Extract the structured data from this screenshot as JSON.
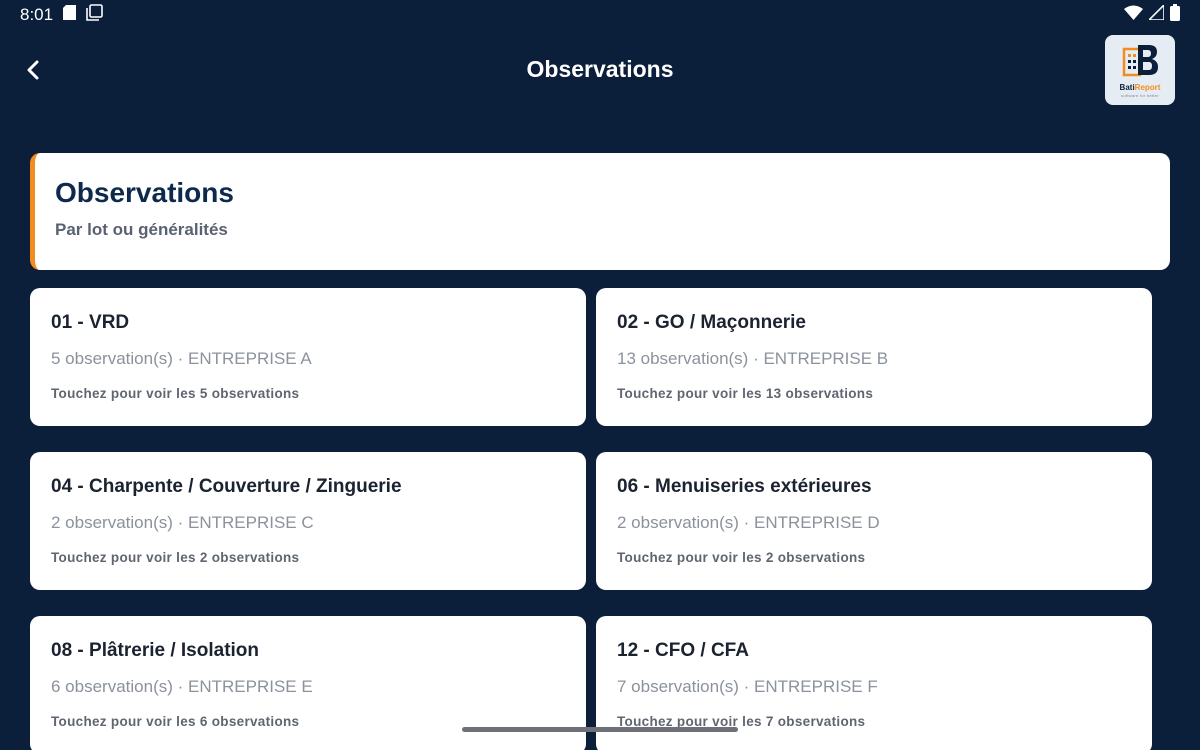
{
  "status_bar": {
    "time": "8:01"
  },
  "app_bar": {
    "title": "Observations",
    "logo": {
      "brand_part1": "Bati",
      "brand_part2": "Report",
      "tagline": "software for better"
    }
  },
  "header": {
    "title": "Observations",
    "subtitle": "Par lot ou généralités"
  },
  "lots": [
    {
      "title": "01 - VRD",
      "meta": "5 observation(s) · ENTREPRISE A",
      "hint": "Touchez pour voir les 5 observations"
    },
    {
      "title": "02 - GO / Maçonnerie",
      "meta": "13 observation(s) · ENTREPRISE B",
      "hint": "Touchez pour voir les 13 observations"
    },
    {
      "title": "04 - Charpente / Couverture / Zinguerie",
      "meta": "2 observation(s) · ENTREPRISE C",
      "hint": "Touchez pour voir les 2 observations"
    },
    {
      "title": "06 - Menuiseries extérieures",
      "meta": "2 observation(s) · ENTREPRISE D",
      "hint": "Touchez pour voir les 2 observations"
    },
    {
      "title": "08 - Plâtrerie / Isolation",
      "meta": "6 observation(s) · ENTREPRISE E",
      "hint": "Touchez pour voir les 6 observations"
    },
    {
      "title": "12 - CFO / CFA",
      "meta": "7 observation(s) · ENTREPRISE F",
      "hint": "Touchez pour voir les 7 observations"
    }
  ],
  "colors": {
    "background": "#0b1f3a",
    "accent": "#f28c1e",
    "card": "#ffffff",
    "heading": "#0d2a4d"
  }
}
